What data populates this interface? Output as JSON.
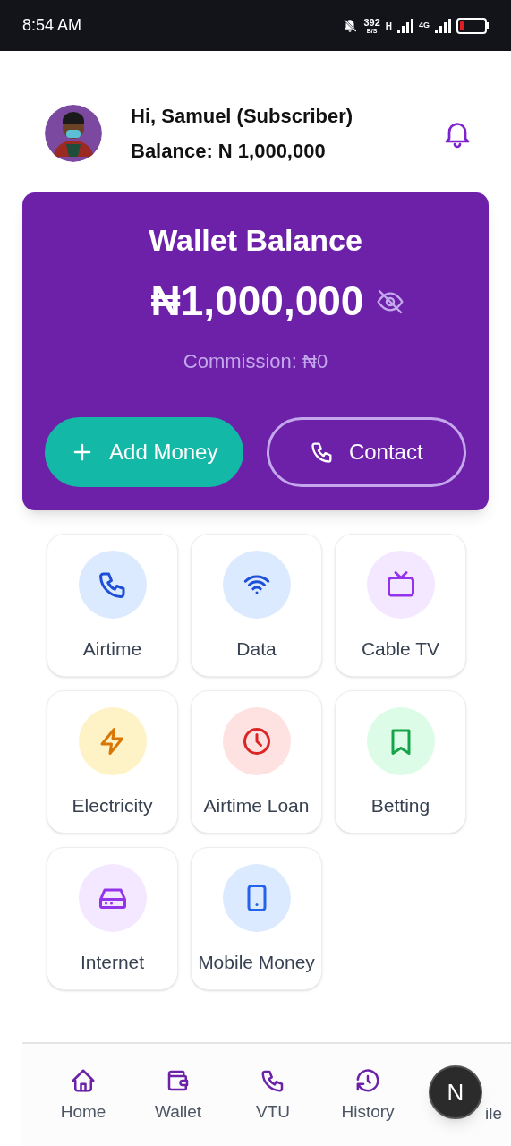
{
  "status_bar": {
    "time": "8:54 AM",
    "speed": "392",
    "speed_unit": "B/S",
    "network_1": "H",
    "network_2": "4G"
  },
  "header": {
    "greeting": "Hi, Samuel (Subscriber)",
    "balance": "Balance: N 1,000,000"
  },
  "wallet": {
    "title": "Wallet Balance",
    "amount": "₦1,000,000",
    "commission": "Commission: ₦0",
    "buttons": [
      {
        "kind": "add",
        "label": "Add Money"
      },
      {
        "kind": "contact",
        "label": "Contact"
      }
    ]
  },
  "services": [
    {
      "kind": "phone",
      "label": "Airtime",
      "color": "#dbeafe"
    },
    {
      "kind": "wifi",
      "label": "Data",
      "color": "#dbeafe"
    },
    {
      "kind": "tv",
      "label": "Cable TV",
      "color": "#f3e8ff"
    },
    {
      "kind": "bolt",
      "label": "Electricity",
      "color": "#fef3c7"
    },
    {
      "kind": "clock",
      "label": "Airtime Loan",
      "color": "#fee2e2"
    },
    {
      "kind": "bookmark",
      "label": "Betting",
      "color": "#dcfce7"
    },
    {
      "kind": "drive",
      "label": "Internet",
      "color": "#f3e8ff"
    },
    {
      "kind": "mobile",
      "label": "Mobile Money",
      "color": "#dbeafe"
    }
  ],
  "bottom_nav": [
    {
      "kind": "home",
      "label": "Home"
    },
    {
      "kind": "wallet",
      "label": "Wallet"
    },
    {
      "kind": "phone",
      "label": "VTU"
    },
    {
      "kind": "history",
      "label": "History"
    },
    {
      "kind": "profile",
      "label": "ile"
    }
  ],
  "overlay_button": {
    "label": "N"
  }
}
